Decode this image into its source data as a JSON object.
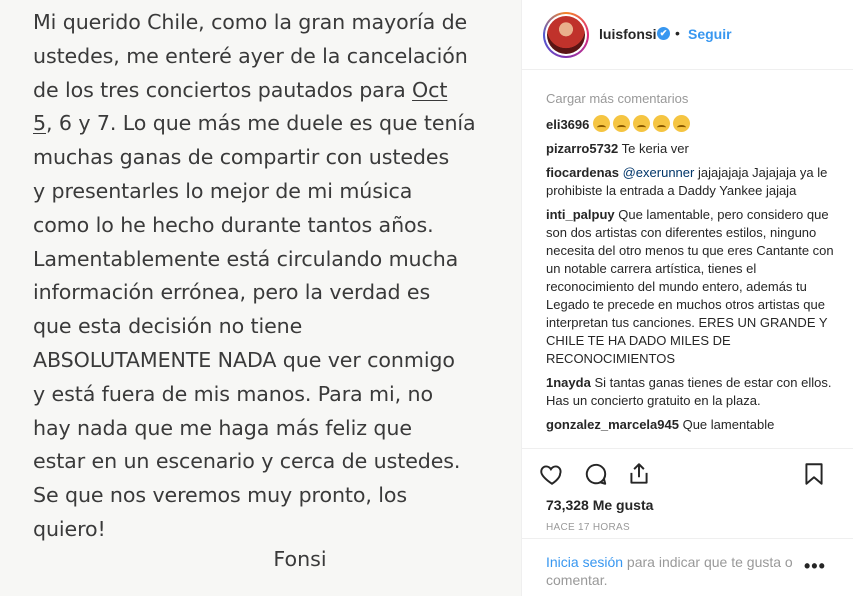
{
  "image": {
    "lines": [
      "Mi querido Chile, como la gran mayoría de",
      "ustedes, me enteré ayer de la cancelación",
      "de los tres conciertos pautados para ",
      "5, 6 y 7. Lo que más me duele es que tenía",
      "muchas ganas de compartir con ustedes",
      "y presentarles lo mejor de mi música",
      "como lo he hecho durante tantos años.",
      "Lamentablemente está circulando mucha",
      "información errónea, pero la verdad es",
      "que esta decisión no tiene",
      "ABSOLUTAMENTE NADA que ver conmigo",
      "y está fuera de mis manos. Para mi, no",
      "hay nada que me haga más feliz que",
      "estar en un escenario y cerca de ustedes.",
      "Se que nos veremos muy pronto, los",
      "quiero!"
    ],
    "underlined_oct": "Oct",
    "underlined_five": "5",
    "signature": "Fonsi"
  },
  "header": {
    "username": "luisfonsi",
    "verified_mark": "✔",
    "separator": "•",
    "follow_label": "Seguir"
  },
  "comments": {
    "load_more": "Cargar más comentarios",
    "items": [
      {
        "user": "eli3696",
        "text": "",
        "emoji_count": 5,
        "emoji": "disappointed-face-emoji"
      },
      {
        "user": "pizarro5732",
        "text": "Te keria ver"
      },
      {
        "user": "fiocardenas",
        "mention": "@exerunner",
        "text": "jajajajaja Jajajaja ya le prohibiste la entrada a Daddy Yankee jajaja"
      },
      {
        "user": "inti_palpuy",
        "text": "Que lamentable, pero considero que son dos artistas con diferentes estilos, ninguno necesita del otro menos tu que eres Cantante con un notable carrera artística, tienes el reconocimiento del mundo entero, además tu Legado te precede en muchos otros artistas que interpretan tus canciones. ERES UN GRANDE Y CHILE TE HA DADO MILES DE RECONOCIMIENTOS"
      },
      {
        "user": "1nayda",
        "text": "Si tantas ganas tienes de estar con ellos. Has un concierto gratuito en la plaza."
      },
      {
        "user": "gonzalez_marcela945",
        "text": "Que lamentable"
      }
    ]
  },
  "actions": {
    "like_icon": "heart-icon",
    "comment_icon": "comment-icon",
    "share_icon": "share-icon",
    "save_icon": "bookmark-icon"
  },
  "likes": "73,328 Me gusta",
  "timestamp": "HACE 17 HORAS",
  "login": {
    "link_label": "Inicia sesión",
    "text": " para indicar que te gusta o comentar.",
    "more_icon": "more-options-icon",
    "more_label": "•••"
  },
  "colors": {
    "accent": "#3897f0",
    "text": "#262626",
    "muted": "#999999",
    "image_bg": "#f7f7f5"
  }
}
